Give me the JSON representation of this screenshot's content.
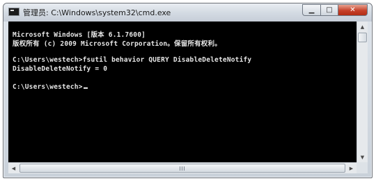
{
  "window": {
    "title": "管理员: C:\\Windows\\system32\\cmd.exe",
    "minimize_glyph": "▁",
    "maximize_glyph": "□",
    "close_glyph": "✕"
  },
  "console": {
    "lines": [
      "Microsoft Windows [版本 6.1.7600]",
      "版权所有 (c) 2009 Microsoft Corporation。保留所有权利。",
      "",
      "C:\\Users\\westech>fsutil behavior QUERY DisableDeleteNotify",
      "DisableDeleteNotify = 0",
      "",
      "C:\\Users\\westech>"
    ]
  },
  "scrollbars": {
    "up_glyph": "▲",
    "down_glyph": "▼",
    "left_glyph": "◀",
    "right_glyph": "▶"
  },
  "colors": {
    "console_bg": "#000000",
    "console_fg": "#e6e6e6",
    "close_button": "#c7412a"
  },
  "icons": [
    "cmd-app-icon",
    "minimize-icon",
    "maximize-icon",
    "close-icon",
    "scroll-up-icon",
    "scroll-down-icon",
    "scroll-left-icon",
    "scroll-right-icon"
  ]
}
